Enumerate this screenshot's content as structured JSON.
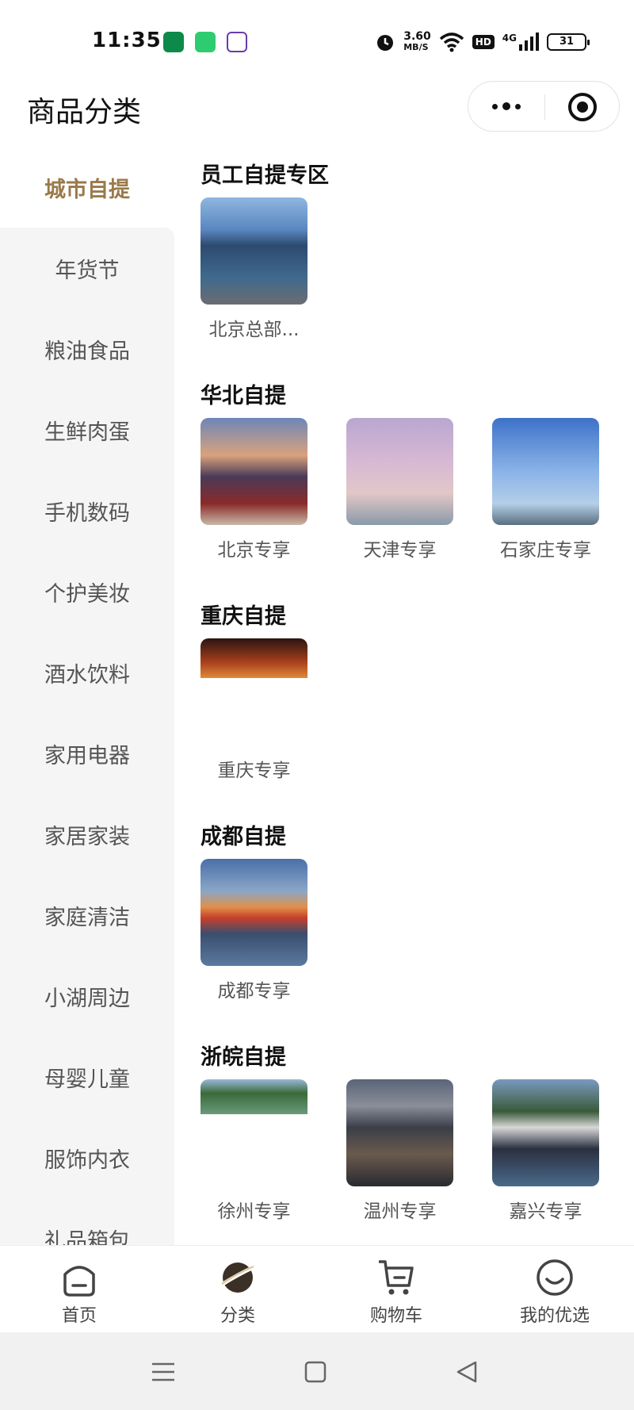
{
  "status_bar": {
    "time": "11:35",
    "net_speed_value": "3.60",
    "net_speed_unit": "MB/S",
    "hd": "HD",
    "signal": "4G",
    "battery": "31"
  },
  "header": {
    "title": "商品分类"
  },
  "sidebar": {
    "items": [
      {
        "label": "城市自提"
      },
      {
        "label": "年货节"
      },
      {
        "label": "粮油食品"
      },
      {
        "label": "生鲜肉蛋"
      },
      {
        "label": "手机数码"
      },
      {
        "label": "个护美妆"
      },
      {
        "label": "酒水饮料"
      },
      {
        "label": "家用电器"
      },
      {
        "label": "家居家装"
      },
      {
        "label": "家庭清洁"
      },
      {
        "label": "小湖周边"
      },
      {
        "label": "母婴儿童"
      },
      {
        "label": "服饰内衣"
      },
      {
        "label": "礼品箱包"
      }
    ]
  },
  "sections": [
    {
      "title": "员工自提专区",
      "items": [
        {
          "label": "北京总部..."
        }
      ]
    },
    {
      "title": "华北自提",
      "items": [
        {
          "label": "北京专享"
        },
        {
          "label": "天津专享"
        },
        {
          "label": "石家庄专享"
        }
      ]
    },
    {
      "title": "重庆自提",
      "items": [
        {
          "label": "重庆专享"
        }
      ]
    },
    {
      "title": "成都自提",
      "items": [
        {
          "label": "成都专享"
        }
      ]
    },
    {
      "title": "浙皖自提",
      "items": [
        {
          "label": "徐州专享"
        },
        {
          "label": "温州专享"
        },
        {
          "label": "嘉兴专享"
        }
      ]
    }
  ],
  "tabbar": {
    "items": [
      {
        "label": "首页"
      },
      {
        "label": "分类"
      },
      {
        "label": "购物车"
      },
      {
        "label": "我的优选"
      }
    ]
  },
  "colors": {
    "accent": "#9a7a4a",
    "sidebar_bg": "#f5f5f5"
  }
}
